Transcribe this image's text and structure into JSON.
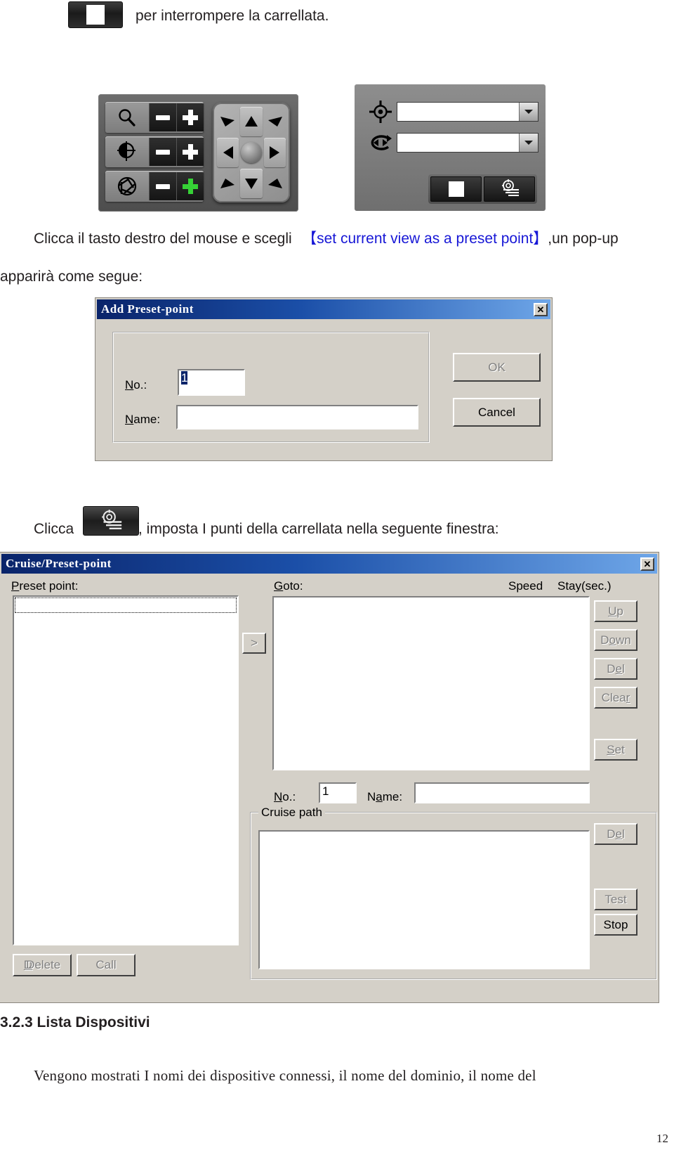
{
  "intro": {
    "stop_icon": "stop-square-icon",
    "text": "per interrompere la carrellata."
  },
  "ptz_panel": {
    "name": "ptz-control-panel",
    "rows": [
      {
        "icon": "zoom-magnifier-icon",
        "minus": "−",
        "plus": "+",
        "plus_color": "#ffffff"
      },
      {
        "icon": "focus-crosshair-icon",
        "minus": "−",
        "plus": "+",
        "plus_color": "#ffffff"
      },
      {
        "icon": "iris-aperture-icon",
        "minus": "−",
        "plus": "+",
        "plus_color": "#36d136"
      }
    ],
    "pad": {
      "up": "arrow-up",
      "down": "arrow-down",
      "left": "arrow-left",
      "right": "arrow-right",
      "up_left": "arrow-up-left",
      "up_right": "arrow-up-right",
      "down_left": "arrow-down-left",
      "down_right": "arrow-down-right",
      "center": "joystick-center-knob"
    }
  },
  "selector_panel": {
    "preset_icon": "preset-target-icon",
    "cruise_icon": "cruise-loop-icon",
    "preset_combo_value": "",
    "cruise_combo_value": "",
    "stop_icon": "stop-square-icon",
    "cruise_setup_icon": "cruise-preset-icon"
  },
  "paragraph1": {
    "before": "Clicca il tasto destro del mouse e scegli",
    "highlight": "【set current view as a preset point】",
    "after": ",un pop-up",
    "line2": "apparirà come segue:"
  },
  "add_preset_dialog": {
    "title": "Add Preset-point",
    "close_label": "✕",
    "no_label": "No.:",
    "no_value": "1",
    "name_label": "Name:",
    "name_value": "",
    "ok_label": "OK",
    "ok_enabled": false,
    "cancel_label": "Cancel",
    "cancel_enabled": true
  },
  "paragraph2": {
    "before": "Clicca",
    "icon": "cruise-preset-icon",
    "after": ", imposta I punti della carrellata nella seguente finestra:"
  },
  "cruise_dialog": {
    "title": "Cruise/Preset-point",
    "close_label": "✕",
    "preset_point_label": "Preset point:",
    "preset_point_items": [],
    "transfer_button": ">",
    "goto_label": "Goto:",
    "speed_label": "Speed",
    "stay_label": "Stay(sec.)",
    "goto_items": [],
    "side_buttons": [
      {
        "label": "Up",
        "enabled": false
      },
      {
        "label": "Down",
        "enabled": false
      },
      {
        "label": "Del",
        "enabled": false
      },
      {
        "label": "Clear",
        "enabled": false
      },
      {
        "label": "Set",
        "enabled": false
      }
    ],
    "no_label": "No.:",
    "no_value": "1",
    "name_label": "Name:",
    "name_value": "",
    "cruise_path_label": "Cruise path",
    "cruise_path_items": [],
    "cruise_buttons": [
      {
        "label": "Del",
        "enabled": false
      },
      {
        "label": "Test",
        "enabled": false
      },
      {
        "label": "Stop",
        "enabled": true
      }
    ],
    "delete_label": "Delete",
    "delete_enabled": false,
    "call_label": "Call",
    "call_enabled": false
  },
  "section": {
    "heading": "3.2.3 Lista Dispositivi",
    "body": "Vengono mostrati I nomi dei dispositive connessi, il nome del dominio, il nome del"
  },
  "footer": {
    "page_number": "12"
  },
  "colors": {
    "link_blue": "#1717d6",
    "title_blue": "#0a246a",
    "dialog_face": "#d4d0c8",
    "accent_green": "#36d136"
  }
}
